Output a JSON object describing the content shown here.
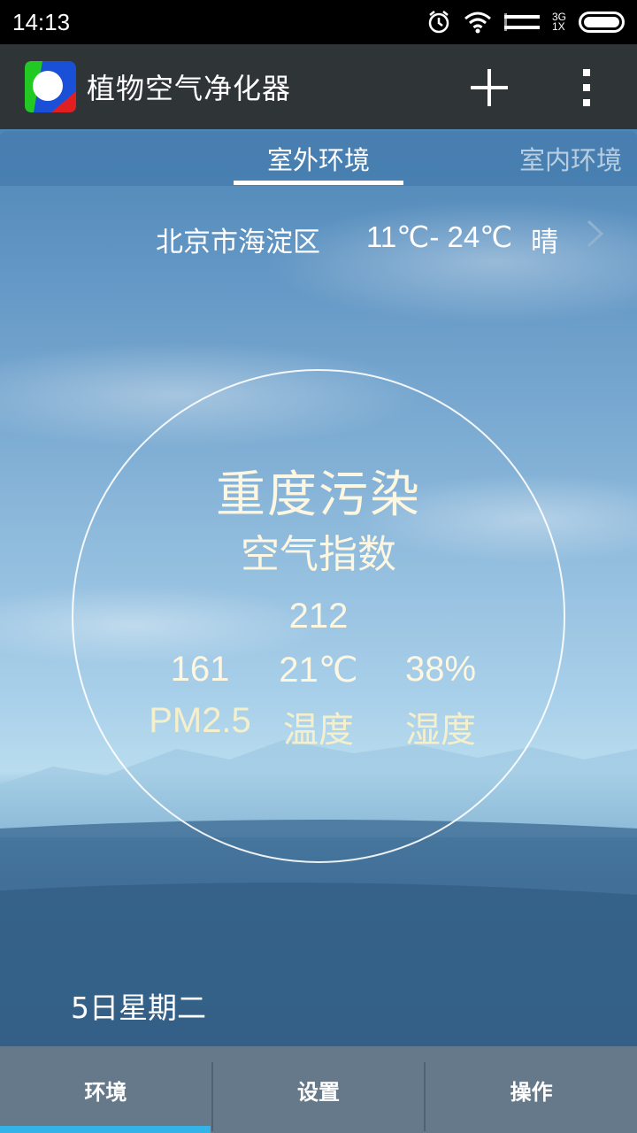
{
  "status_bar": {
    "time": "14:13",
    "network_top": "3G",
    "network_bottom": "1X",
    "icons": [
      "alarm-icon",
      "wifi-icon",
      "signal-icon",
      "battery-icon"
    ]
  },
  "action_bar": {
    "title": "植物空气净化器",
    "actions": [
      "add-icon",
      "overflow-menu-icon"
    ]
  },
  "tabs": [
    {
      "label": "室外环境",
      "active": true
    },
    {
      "label": "室内环境",
      "active": false
    }
  ],
  "location": {
    "city": "北京市海淀区",
    "temp_range": "11℃- 24℃",
    "weather": "晴"
  },
  "air": {
    "level": "重度污染",
    "label": "空气指数",
    "index": "212",
    "metrics": [
      {
        "value": "161",
        "label": "PM2.5"
      },
      {
        "value": "21℃",
        "label": "温度"
      },
      {
        "value": "38%",
        "label": "湿度"
      }
    ]
  },
  "date": "5日星期二",
  "bottom_nav": {
    "items": [
      {
        "label": "环境",
        "active": true
      },
      {
        "label": "设置",
        "active": false
      },
      {
        "label": "操作",
        "active": false
      }
    ],
    "active_color": "#34b3e8"
  },
  "colors": {
    "action_bar": "#2f3437",
    "bottom_nav": "#66798a",
    "text_cream": "#fdf6e0"
  }
}
